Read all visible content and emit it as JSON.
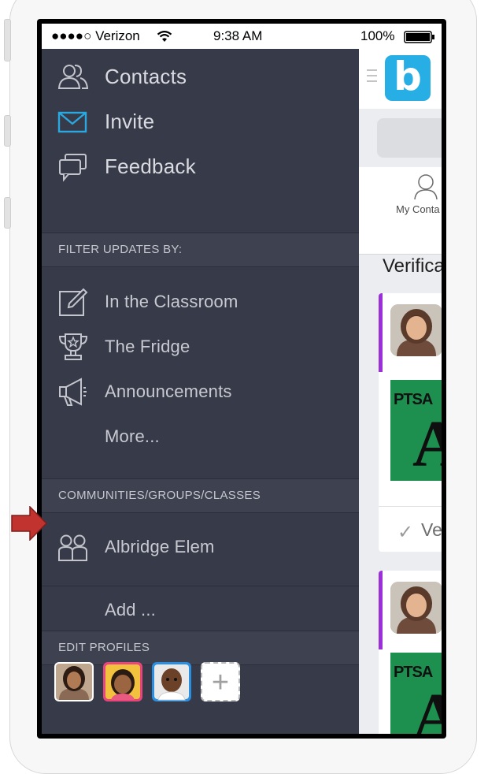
{
  "status_bar": {
    "carrier": "●●●●○ Verizon",
    "time": "9:38 AM",
    "battery": "100%"
  },
  "menu": {
    "top_items": [
      {
        "label": "Contacts",
        "icon": "contacts-icon"
      },
      {
        "label": "Invite",
        "icon": "envelope-icon"
      },
      {
        "label": "Feedback",
        "icon": "feedback-bubbles-icon"
      }
    ],
    "filter_header": "FILTER UPDATES BY:",
    "filter_items": [
      {
        "label": "In the Classroom",
        "icon": "pencil-icon"
      },
      {
        "label": "The Fridge",
        "icon": "trophy-icon"
      },
      {
        "label": "Announcements",
        "icon": "megaphone-icon"
      },
      {
        "label": "More...",
        "icon": ""
      }
    ],
    "groups_header": "COMMUNITIES/GROUPS/CLASSES",
    "group_items": [
      {
        "label": "Albridge Elem",
        "icon": "group-icon"
      }
    ],
    "add_label": "Add ...",
    "profiles_header": "EDIT PROFILES",
    "profiles": [
      {
        "name": "woman-avatar",
        "border": "#ffffff"
      },
      {
        "name": "girl-avatar",
        "border": "#e8457e"
      },
      {
        "name": "boy-avatar",
        "border": "#2a8fe0"
      }
    ],
    "add_profile_label": "+"
  },
  "app": {
    "logo": "b",
    "tab_label": "My Conta",
    "section_title": "Verifica",
    "card_image_text": "PTSA",
    "card_image_letter": "A",
    "verify_label": "Ve",
    "verify_check": "✓"
  },
  "colors": {
    "menu_bg": "#373a48",
    "section_bg": "#3e4150",
    "accent_purple": "#9b30d9",
    "brand_blue": "#27aee5",
    "invite_blue": "#2aa8e0",
    "pointer_red": "#c0332f"
  }
}
